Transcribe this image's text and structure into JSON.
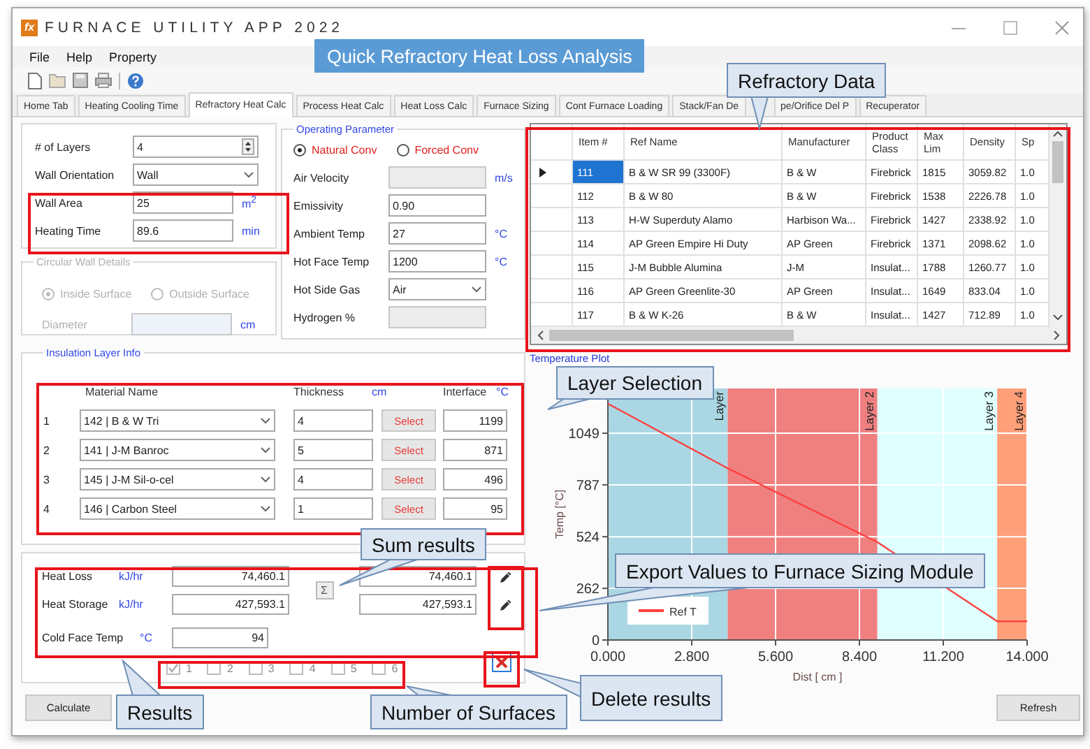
{
  "window": {
    "logo": "fx",
    "title": "FURNACE UTILITY APP 2022"
  },
  "menu": [
    "File",
    "Help",
    "Property"
  ],
  "tabs": [
    {
      "label": "Home Tab",
      "selected": false
    },
    {
      "label": "Heating Cooling Time",
      "selected": false
    },
    {
      "label": "Refractory Heat Calc",
      "selected": true
    },
    {
      "label": "Process Heat Calc",
      "selected": false
    },
    {
      "label": "Heat Loss Calc",
      "selected": false
    },
    {
      "label": "Furnace Sizing",
      "selected": false
    },
    {
      "label": "Cont Furnace Loading",
      "selected": false
    },
    {
      "label": "Stack/Fan De",
      "selected": false
    },
    {
      "label": "pe/Orifice Del P",
      "selected": false
    },
    {
      "label": "Recuperator",
      "selected": false
    }
  ],
  "layer_setup": {
    "fields": [
      {
        "label": "# of Layers",
        "value": "4",
        "kind": "spinner"
      },
      {
        "label": "Wall Orientation",
        "value": "Wall",
        "kind": "dropdown"
      },
      {
        "label": "Wall Area",
        "value": "25",
        "unit": "m$^{2}$",
        "kind": "text"
      },
      {
        "label": "Heating Time",
        "value": "89.6",
        "unit": "min",
        "kind": "text"
      }
    ]
  },
  "circular_wall": {
    "title": "Circular Wall Details",
    "disabled": true,
    "options": [
      {
        "label": "Inside Surface",
        "selected": true
      },
      {
        "label": "Outside Surface",
        "selected": false
      }
    ],
    "diameter": {
      "label": "Diameter",
      "unit": "cm"
    }
  },
  "operating_parameter": {
    "title": "Operating Parameter",
    "convection": [
      {
        "label": "Natural Conv",
        "selected": true
      },
      {
        "label": "Forced Conv",
        "selected": false
      }
    ],
    "fields": [
      {
        "label": "Air Velocity",
        "unit": "m/s",
        "kind": "text",
        "disabled": true
      },
      {
        "label": "Emissivity",
        "value": "0.90",
        "kind": "text",
        "disabled": false
      },
      {
        "label": "Ambient Temp",
        "value": "27",
        "unit": "°C",
        "kind": "text",
        "disabled": false
      },
      {
        "label": "Hot Face Temp",
        "value": "1200",
        "unit": "°C",
        "kind": "text",
        "disabled": false
      },
      {
        "label": "Hot Side Gas",
        "value": "Air",
        "kind": "dropdown",
        "disabled": false
      },
      {
        "label": "Hydrogen %",
        "kind": "text",
        "disabled": true
      }
    ]
  },
  "insulation": {
    "title": "Insulation Layer Info",
    "material_header": "Material Name",
    "thickness_header": "Thickness",
    "thickness_unit": "cm",
    "interface_header": "Interface",
    "interface_unit": "°C",
    "layers": [
      {
        "index": "1",
        "material": "142 | B & W Tri",
        "thickness": "4",
        "select": "Select",
        "interface": "1199"
      },
      {
        "index": "2",
        "material": "141 | J-M Banroc",
        "thickness": "5",
        "select": "Select",
        "interface": "871"
      },
      {
        "index": "3",
        "material": "145 | J-M Sil-o-cel",
        "thickness": "4",
        "select": "Select",
        "interface": "496"
      },
      {
        "index": "4",
        "material": "146 | Carbon Steel",
        "thickness": "1",
        "select": "Select",
        "interface": "95"
      }
    ]
  },
  "results": {
    "rows": [
      {
        "label": "Heat Loss",
        "unit": "kJ/hr",
        "value": "74,460.1",
        "total": "74,460.1"
      },
      {
        "label": "Heat Storage",
        "unit": "kJ/hr",
        "value": "427,593.1",
        "total": "427,593.1"
      }
    ],
    "sum_button": "Σ",
    "cold_face": {
      "label": "Cold Face Temp",
      "unit": "°C",
      "value": "94"
    },
    "surfaces": [
      {
        "label": "1",
        "checked": true
      },
      {
        "label": "2",
        "checked": false
      },
      {
        "label": "3",
        "checked": false
      },
      {
        "label": "4",
        "checked": false
      },
      {
        "label": "5",
        "checked": false
      },
      {
        "label": "6",
        "checked": false
      }
    ]
  },
  "refractory_table": {
    "columns": [
      "Item #",
      "Ref Name",
      "Manufacturer",
      "Product Class",
      "Max Lim",
      "Density",
      "Sp"
    ],
    "rows": [
      {
        "selected": true,
        "cells": [
          "111",
          "B & W SR 99 (3300F)",
          "B & W",
          "Firebrick",
          "1815",
          "3059.82",
          "1.0"
        ]
      },
      {
        "selected": false,
        "cells": [
          "112",
          "B & W 80",
          "B & W",
          "Firebrick",
          "1538",
          "2226.78",
          "1.0"
        ]
      },
      {
        "selected": false,
        "cells": [
          "113",
          "H-W Superduty Alamo",
          "Harbison Wa...",
          "Firebrick",
          "1427",
          "2338.92",
          "1.0"
        ]
      },
      {
        "selected": false,
        "cells": [
          "114",
          "AP Green Empire Hi Duty",
          "AP Green",
          "Firebrick",
          "1371",
          "2098.62",
          "1.0"
        ]
      },
      {
        "selected": false,
        "cells": [
          "115",
          "J-M Bubble Alumina",
          "J-M",
          "Insulat...",
          "1788",
          "1260.77",
          "1.0"
        ]
      },
      {
        "selected": false,
        "cells": [
          "116",
          "AP Green Greenlite-30",
          "AP Green",
          "Insulat...",
          "1649",
          "833.04",
          "1.0"
        ]
      },
      {
        "selected": false,
        "cells": [
          "117",
          "B & W K-26",
          "B & W",
          "Insulat...",
          "1427",
          "712.89",
          "1.0"
        ]
      }
    ]
  },
  "temperature_plot": {
    "title": "Temperature Plot",
    "chart_data": {
      "type": "line",
      "xlabel": "Dist [ cm ]",
      "ylabel": "Temp [°C]",
      "x": [
        0,
        4,
        9,
        13,
        14
      ],
      "series": [
        {
          "name": "Ref T",
          "color": "#ff4040",
          "values": [
            1199,
            871,
            496,
            95,
            95
          ]
        }
      ],
      "xlim": [
        0,
        14
      ],
      "ylim": [
        0,
        1276
      ],
      "xticks": [
        {
          "value": 0,
          "label": "0.000"
        },
        {
          "value": 2.8,
          "label": "2.800"
        },
        {
          "value": 5.6,
          "label": "5.600"
        },
        {
          "value": 8.4,
          "label": "8.400"
        },
        {
          "value": 11.2,
          "label": "11.200"
        },
        {
          "value": 14,
          "label": "14.000"
        }
      ],
      "yticks": [
        0,
        262,
        524,
        787,
        1049
      ],
      "grid": true,
      "bands": [
        {
          "axis": "x",
          "from": 0,
          "to": 4,
          "label": "Layer",
          "color": "#aad7e3"
        },
        {
          "axis": "x",
          "from": 4,
          "to": 9,
          "label": "Layer 2",
          "color": "#f08080"
        },
        {
          "axis": "x",
          "from": 9,
          "to": 13,
          "label": "Layer 3",
          "color": "#e0ffff"
        },
        {
          "axis": "x",
          "from": 13,
          "to": 14,
          "label": "Layer 4",
          "color": "#ffa07a"
        }
      ]
    }
  },
  "buttons": {
    "calculate": "Calculate",
    "refresh": "Refresh"
  },
  "callouts": [
    {
      "text": "Quick Refractory Heat Loss Analysis",
      "kind": "banner"
    },
    {
      "text": "Refractory Data",
      "kind": "callout"
    },
    {
      "text": "Layer Selection",
      "kind": "callout"
    },
    {
      "text": "Sum results",
      "kind": "callout"
    },
    {
      "text": "Export Values to Furnace Sizing Module",
      "kind": "callout"
    },
    {
      "text": "Results",
      "kind": "callout"
    },
    {
      "text": "Number of Surfaces",
      "kind": "callout"
    },
    {
      "text": "Delete results",
      "kind": "callout"
    }
  ]
}
